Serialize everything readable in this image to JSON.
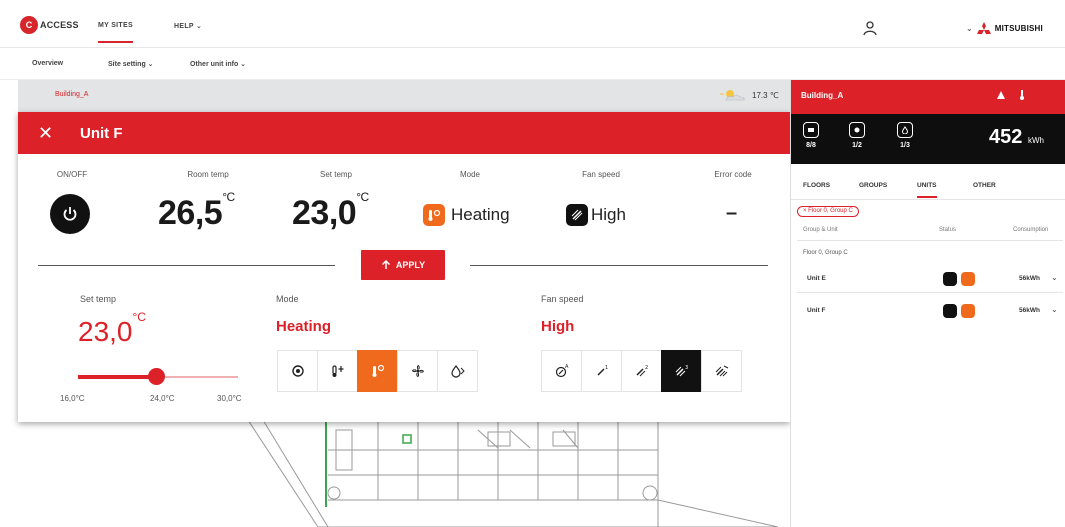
{
  "nav": {
    "logo_mark": "C",
    "logo_text": "ACCESS",
    "my_sites": "MY SITES",
    "help": "HELP ⌄",
    "brand": "MITSUBISHI",
    "brand_chevron": "⌄"
  },
  "subnav": {
    "overview": "Overview",
    "site_setting": "Site setting ⌄",
    "other_unit_info": "Other unit info ⌄"
  },
  "building": {
    "name": "Building_A",
    "outdoor_temp": "17.3 ℃"
  },
  "panel": {
    "close": "✕",
    "title": "Unit F",
    "labels": {
      "onoff": "ON/OFF",
      "room_temp": "Room temp",
      "set_temp": "Set temp",
      "mode": "Mode",
      "fan_speed": "Fan speed",
      "error_code": "Error code"
    },
    "room_temp": "26,5",
    "set_temp": "23,0",
    "deg": "°C",
    "mode": "Heating",
    "fan_speed": "High",
    "error_code": "–",
    "apply": "APPLY",
    "controls": {
      "set_temp_label": "Set temp",
      "set_temp_value": "23,0",
      "mode_label": "Mode",
      "mode_value": "Heating",
      "fan_label": "Fan speed",
      "fan_value": "High",
      "slider_level": 0.5,
      "ticks": [
        "16,0°C",
        "24,0°C",
        "30,0°C"
      ]
    }
  },
  "right": {
    "title": "Building_A",
    "stats": [
      "8/8",
      "1/2",
      "1/3"
    ],
    "kwh": "452",
    "kwh_unit": "kWh",
    "tabs": [
      "FLOORS",
      "GROUPS",
      "UNITS",
      "OTHER"
    ],
    "filter": "× Floor 0, Group C",
    "col_group": "Group & Unit",
    "col_status": "Status",
    "col_consumption": "Consumption",
    "group_name": "Floor 0, Group C",
    "rows": [
      {
        "unit": "Unit E",
        "consumption": "56kWh"
      },
      {
        "unit": "Unit F",
        "consumption": "56kWh"
      }
    ]
  },
  "colors": {
    "accent": "#dc2128",
    "heating": "#ef6a1d",
    "dark": "#111111"
  },
  "icons": [
    "user-icon",
    "power-icon",
    "heating-icon",
    "fan-icon",
    "weather-icon",
    "alert-icon",
    "thermometer-icon"
  ]
}
